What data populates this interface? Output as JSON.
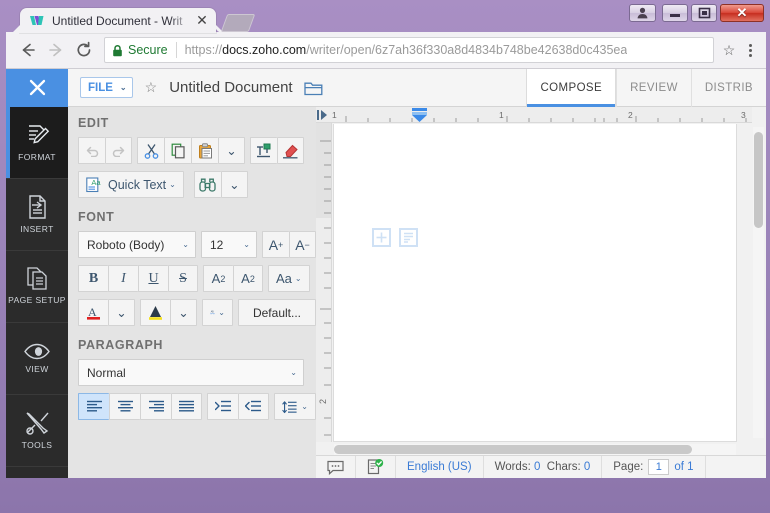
{
  "window": {
    "caption_buttons": [
      {
        "name": "user-account-button",
        "glyph": "user"
      },
      {
        "name": "minimize-button",
        "glyph": "minimize"
      },
      {
        "name": "maximize-button",
        "glyph": "maximize"
      },
      {
        "name": "close-button",
        "glyph": "✕"
      }
    ]
  },
  "browser": {
    "tab": {
      "title": "Untitled Document - Writ",
      "close_label": "✕",
      "favicon": "zoho-writer-icon"
    },
    "new_tab_label": "",
    "nav": {
      "back": "←",
      "forward": "→",
      "reload": "C"
    },
    "omnibox": {
      "security_label": "Secure",
      "url_scheme": "https://",
      "url_host": "docs.zoho.com",
      "url_path": "/writer/open/6z7ah36f330a8d4834b748be42638d0c435ea",
      "star": "☆"
    }
  },
  "app": {
    "header": {
      "close_doc_label": "✕",
      "file_menu_label": "FILE",
      "file_menu_caret": "⌄",
      "star": "☆",
      "doc_title": "Untitled Document",
      "folder_icon": "folder-icon"
    },
    "mode_tabs": [
      {
        "label": "COMPOSE",
        "active": true
      },
      {
        "label": "REVIEW",
        "active": false
      },
      {
        "label": "DISTRIB",
        "active": false
      }
    ],
    "rail": [
      {
        "label": "FORMAT",
        "icon": "format-pencil-icon",
        "active": true
      },
      {
        "label": "INSERT",
        "icon": "insert-page-icon",
        "active": false
      },
      {
        "label": "PAGE\nSETUP",
        "icon": "page-setup-icon",
        "active": false
      },
      {
        "label": "VIEW",
        "icon": "eye-icon",
        "active": false
      },
      {
        "label": "TOOLS",
        "icon": "tools-icon",
        "active": false
      }
    ],
    "panel": {
      "edit": {
        "title": "EDIT",
        "undo": "undo-icon",
        "redo": "redo-icon",
        "cut": "scissors-icon",
        "copy": "copy-icon",
        "paste": "paste-icon",
        "paste_caret": "⌄",
        "format_painter": "format-painter-icon",
        "clear_format": "clear-formatting-icon",
        "quick_text_label": "Quick Text",
        "quick_text_caret": "⌄",
        "find": "binoculars-icon",
        "find_caret": "⌄"
      },
      "font": {
        "title": "FONT",
        "family": "Roboto (Body)",
        "size": "12",
        "increase_label": "A",
        "increase_sup": "+",
        "decrease_label": "A",
        "decrease_sup": "−",
        "bold": "B",
        "italic": "I",
        "underline": "U",
        "strikethrough": "S",
        "superscript_base": "A",
        "superscript_sup": "2",
        "subscript_base": "A",
        "subscript_sub": "2",
        "case_label": "Aa",
        "case_caret": "⌄",
        "text_color": "A",
        "text_color_caret": "⌄",
        "highlight": "A",
        "highlight_caret": "⌄",
        "spacing_label": "AB",
        "spacing_caret": "⌄",
        "default_label": "Default..."
      },
      "paragraph": {
        "title": "PARAGRAPH",
        "style": "Normal",
        "style_caret": "⌄",
        "align_left": "align-left-icon",
        "align_center": "align-center-icon",
        "align_right": "align-right-icon",
        "align_justify": "align-justify-icon",
        "indent_increase": "indent-increase-icon",
        "indent_decrease": "indent-decrease-icon",
        "line_spacing": "line-spacing-icon",
        "line_spacing_caret": "⌄"
      }
    },
    "ruler": {
      "h_marks": [
        "1",
        "1",
        "2",
        "3"
      ],
      "v_marks": [
        "2"
      ]
    },
    "statusbar": {
      "comment_icon": "comment-icon",
      "spellcheck_icon": "spellcheck-icon",
      "language": "English (US)",
      "words_label": "Words:",
      "words_value": "0",
      "chars_label": "Chars:",
      "chars_value": "0",
      "page_label": "Page:",
      "page_value": "1",
      "page_of": "of 1"
    }
  },
  "colors": {
    "accent_blue": "#4a90e2",
    "rail_dark": "#2b2b2b",
    "panel_gray": "#e4e4e4",
    "secure_green": "#1f7a33",
    "frame_purple": "#9d86bb"
  }
}
